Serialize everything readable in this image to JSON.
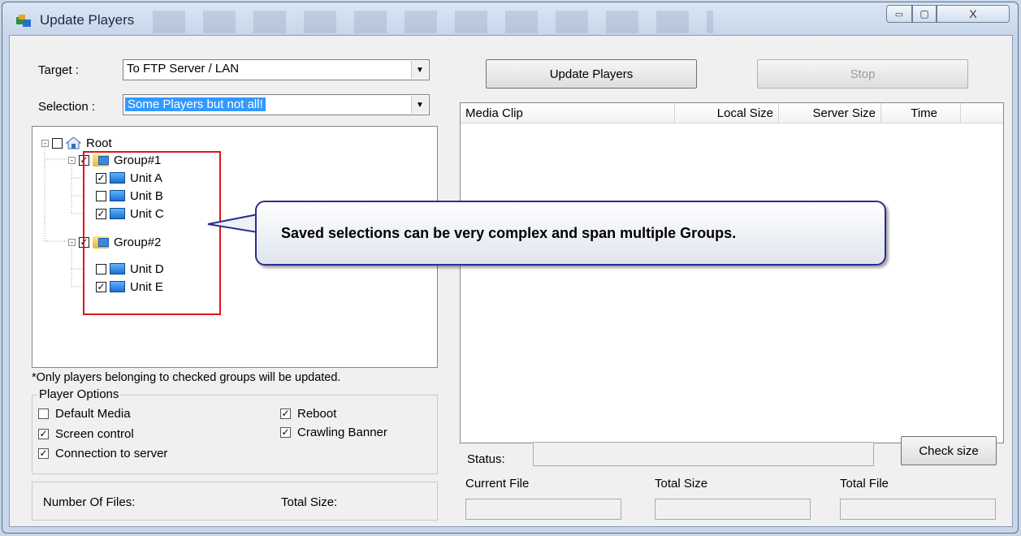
{
  "window": {
    "title": "Update Players",
    "controls": {
      "minimize": "▭",
      "maximize": "▢",
      "close": "X"
    }
  },
  "target": {
    "label": "Target :",
    "value": "To FTP Server / LAN"
  },
  "selection": {
    "label": "Selection :",
    "value": "Some Players but not all!"
  },
  "tree": {
    "root": {
      "label": "Root",
      "expander": "-",
      "checked": false
    },
    "groups": [
      {
        "label": "Group#1",
        "expander": "-",
        "checked": true,
        "units": [
          {
            "label": "Unit A",
            "checked": true
          },
          {
            "label": "Unit B",
            "checked": false
          },
          {
            "label": "Unit C",
            "checked": true
          }
        ]
      },
      {
        "label": "Group#2",
        "expander": "-",
        "checked": true,
        "units": [
          {
            "label": "Unit D",
            "checked": false
          },
          {
            "label": "Unit E",
            "checked": true
          }
        ]
      }
    ]
  },
  "note": "*Only players belonging to checked groups will be updated.",
  "player_options": {
    "title": "Player Options",
    "items": [
      {
        "label": "Default Media",
        "checked": false
      },
      {
        "label": "Screen control",
        "checked": true
      },
      {
        "label": "Connection to server",
        "checked": true
      },
      {
        "label": "Reboot",
        "checked": true
      },
      {
        "label": "Crawling Banner",
        "checked": true
      }
    ]
  },
  "footer": {
    "files_label": "Number Of Files:",
    "size_label": "Total Size:"
  },
  "buttons": {
    "update": "Update Players",
    "stop": "Stop",
    "check_size": "Check size"
  },
  "list": {
    "columns": [
      "Media Clip",
      "Local Size",
      "Server Size",
      "Time"
    ]
  },
  "status": {
    "label": "Status:",
    "value": ""
  },
  "progress": {
    "current_file": "Current File",
    "total_size": "Total Size",
    "total_file": "Total File"
  },
  "callout": {
    "text": "Saved selections can be very complex and span multiple Groups."
  },
  "colors": {
    "highlight": "#3399ff",
    "red_box": "#e0141a",
    "callout_border": "#2b2f8a"
  }
}
